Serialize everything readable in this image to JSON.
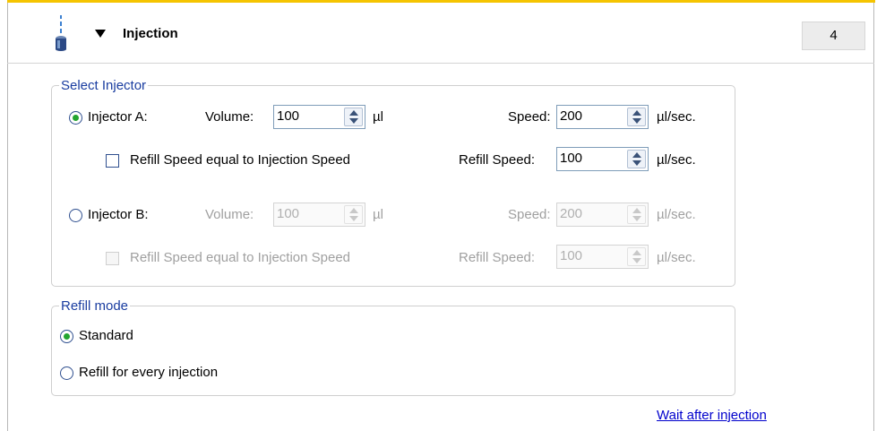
{
  "header": {
    "title": "Injection",
    "step_number": "4"
  },
  "select_injector": {
    "legend": "Select Injector",
    "injector_a": {
      "label": "Injector A:",
      "selected": true,
      "volume_label": "Volume:",
      "volume_value": "100",
      "volume_unit": "µl",
      "speed_label": "Speed:",
      "speed_value": "200",
      "speed_unit": "µl/sec.",
      "refill_checkbox_label": "Refill Speed equal to Injection Speed",
      "refill_checked": false,
      "refill_speed_label": "Refill Speed:",
      "refill_speed_value": "100",
      "refill_speed_unit": "µl/sec."
    },
    "injector_b": {
      "label": "Injector B:",
      "selected": false,
      "volume_label": "Volume:",
      "volume_value": "100",
      "volume_unit": "µl",
      "speed_label": "Speed:",
      "speed_value": "200",
      "speed_unit": "µl/sec.",
      "refill_checkbox_label": "Refill Speed equal to Injection Speed",
      "refill_checked": false,
      "refill_speed_label": "Refill Speed:",
      "refill_speed_value": "100",
      "refill_speed_unit": "µl/sec."
    }
  },
  "refill_mode": {
    "legend": "Refill mode",
    "options": [
      {
        "label": "Standard",
        "selected": true
      },
      {
        "label": "Refill for every injection",
        "selected": false
      }
    ]
  },
  "footer": {
    "link_label": "Wait after injection"
  },
  "colors": {
    "accent": "#f5c400",
    "radio_dot": "#23a52f",
    "legend_text": "#1a3da0",
    "link": "#0000cc"
  },
  "icons": {
    "header": "injector-icon",
    "expand": "triangle-down-icon"
  }
}
